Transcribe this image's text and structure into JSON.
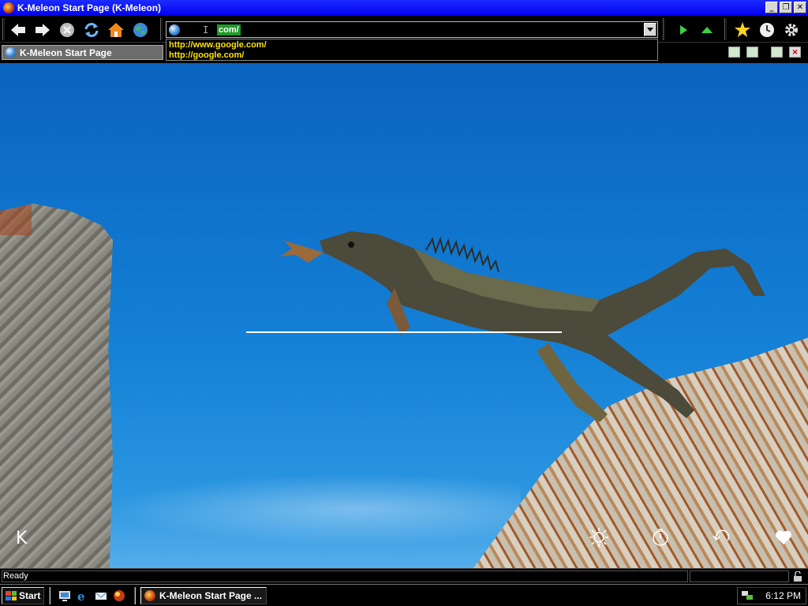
{
  "window": {
    "title": "K-Meleon Start Page (K-Meleon)",
    "min_label": "_",
    "max_label": "❐",
    "close_label": "✕"
  },
  "address": {
    "value": "com/",
    "suggestions": [
      "http://www.google.com/",
      "http://google.com/"
    ]
  },
  "tab": {
    "label": "K-Meleon Start Page"
  },
  "content": {
    "k_label": "K"
  },
  "status": {
    "text": "Ready"
  },
  "taskbar": {
    "start_label": "Start",
    "task_label": "K-Meleon Start Page ...",
    "clock": "6:12 PM"
  },
  "colors": {
    "sky": "#1480d6",
    "url_highlight": "#1e9a2a",
    "suggestion_text": "#ffe400"
  },
  "icons": [
    "back-icon",
    "forward-icon",
    "stop-icon",
    "reload-icon",
    "home-icon",
    "globe-icon",
    "go-icon",
    "up-icon",
    "bookmark-star-icon",
    "history-clock-icon",
    "settings-gear-icon",
    "brightness-icon",
    "timer-icon",
    "undo-icon",
    "heart-icon"
  ]
}
